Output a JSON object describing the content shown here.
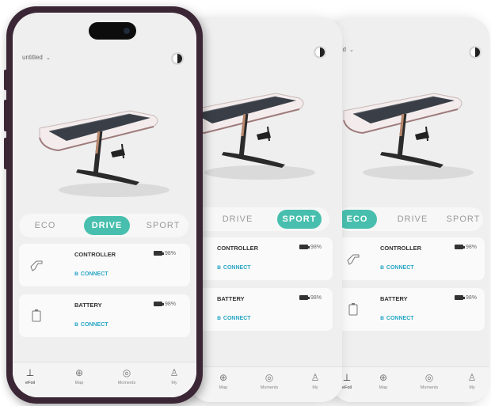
{
  "screens": {
    "a": {
      "title": "untitled",
      "modes": [
        "ECO",
        "DRIVE",
        "SPORT"
      ],
      "active_mode": "DRIVE",
      "cards": [
        {
          "name": "CONTROLLER",
          "percent": "98%",
          "connect": "CONNECT",
          "icon": "controller-icon"
        },
        {
          "name": "BATTERY",
          "percent": "98%",
          "connect": "CONNECT",
          "icon": "battery-icon"
        }
      ],
      "tabs": [
        "eFoil",
        "Map",
        "Moments",
        "My"
      ]
    },
    "b": {
      "modes": [
        "DRIVE",
        "SPORT"
      ],
      "active_mode": "SPORT",
      "cards": [
        {
          "name": "CONTROLLER",
          "percent": "98%",
          "connect": "CONNECT"
        },
        {
          "name": "BATTERY",
          "percent": "98%",
          "connect": "CONNECT"
        }
      ],
      "tabs": [
        "Map",
        "Moments",
        "My"
      ]
    },
    "c": {
      "title": "tled",
      "modes": [
        "ECO",
        "DRIVE",
        "SPORT"
      ],
      "active_mode": "ECO",
      "cards": [
        {
          "name": "CONTROLLER",
          "percent": "98%",
          "connect": "CONNECT",
          "icon": "controller-icon"
        },
        {
          "name": "BATTERY",
          "percent": "98%",
          "connect": "CONNECT",
          "icon": "battery-icon"
        }
      ],
      "tabs": [
        "eFoil",
        "Map",
        "Moments",
        "My"
      ]
    }
  },
  "colors": {
    "accent": "#48bfae",
    "link": "#2aa7c6",
    "phone_frame": "#3b2636"
  },
  "icons": [
    "efoil-board-image",
    "avatar-icon",
    "bluetooth-icon",
    "battery-level-icon",
    "efoil-tab-icon",
    "map-tab-icon",
    "moments-tab-icon",
    "my-tab-icon"
  ]
}
